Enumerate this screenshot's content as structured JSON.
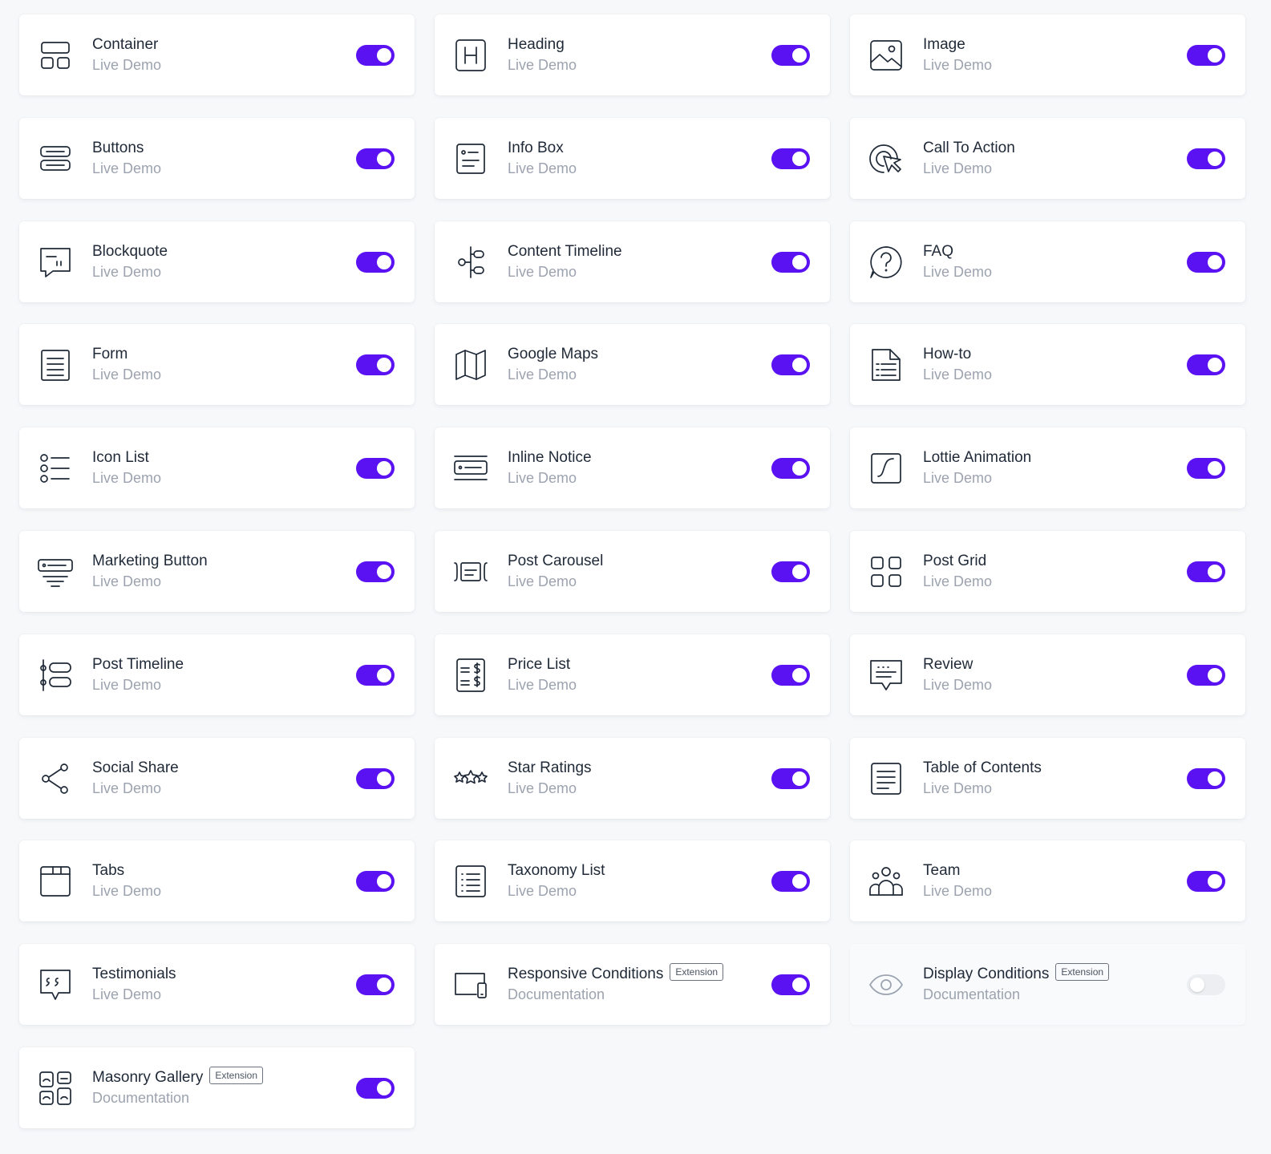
{
  "colors": {
    "accent": "#5b12f2",
    "toggle_off": "#eceef2"
  },
  "widgets": [
    {
      "title": "Container",
      "sub": "Live Demo",
      "icon": "container-icon",
      "on": true
    },
    {
      "title": "Heading",
      "sub": "Live Demo",
      "icon": "heading-icon",
      "on": true
    },
    {
      "title": "Image",
      "sub": "Live Demo",
      "icon": "image-icon",
      "on": true
    },
    {
      "title": "Buttons",
      "sub": "Live Demo",
      "icon": "buttons-icon",
      "on": true
    },
    {
      "title": "Info Box",
      "sub": "Live Demo",
      "icon": "info-box-icon",
      "on": true
    },
    {
      "title": "Call To Action",
      "sub": "Live Demo",
      "icon": "call-to-action-icon",
      "on": true
    },
    {
      "title": "Blockquote",
      "sub": "Live Demo",
      "icon": "blockquote-icon",
      "on": true
    },
    {
      "title": "Content Timeline",
      "sub": "Live Demo",
      "icon": "content-timeline-icon",
      "on": true
    },
    {
      "title": "FAQ",
      "sub": "Live Demo",
      "icon": "faq-icon",
      "on": true
    },
    {
      "title": "Form",
      "sub": "Live Demo",
      "icon": "form-icon",
      "on": true
    },
    {
      "title": "Google Maps",
      "sub": "Live Demo",
      "icon": "map-icon",
      "on": true
    },
    {
      "title": "How-to",
      "sub": "Live Demo",
      "icon": "how-to-icon",
      "on": true
    },
    {
      "title": "Icon List",
      "sub": "Live Demo",
      "icon": "icon-list-icon",
      "on": true
    },
    {
      "title": "Inline Notice",
      "sub": "Live Demo",
      "icon": "inline-notice-icon",
      "on": true
    },
    {
      "title": "Lottie Animation",
      "sub": "Live Demo",
      "icon": "lottie-icon",
      "on": true
    },
    {
      "title": "Marketing Button",
      "sub": "Live Demo",
      "icon": "marketing-button-icon",
      "on": true
    },
    {
      "title": "Post Carousel",
      "sub": "Live Demo",
      "icon": "post-carousel-icon",
      "on": true
    },
    {
      "title": "Post Grid",
      "sub": "Live Demo",
      "icon": "post-grid-icon",
      "on": true
    },
    {
      "title": "Post Timeline",
      "sub": "Live Demo",
      "icon": "post-timeline-icon",
      "on": true
    },
    {
      "title": "Price List",
      "sub": "Live Demo",
      "icon": "price-list-icon",
      "on": true
    },
    {
      "title": "Review",
      "sub": "Live Demo",
      "icon": "review-icon",
      "on": true
    },
    {
      "title": "Social Share",
      "sub": "Live Demo",
      "icon": "share-icon",
      "on": true
    },
    {
      "title": "Star Ratings",
      "sub": "Live Demo",
      "icon": "star-ratings-icon",
      "on": true
    },
    {
      "title": "Table of Contents",
      "sub": "Live Demo",
      "icon": "table-of-contents-icon",
      "on": true
    },
    {
      "title": "Tabs",
      "sub": "Live Demo",
      "icon": "tabs-icon",
      "on": true
    },
    {
      "title": "Taxonomy List",
      "sub": "Live Demo",
      "icon": "taxonomy-list-icon",
      "on": true
    },
    {
      "title": "Team",
      "sub": "Live Demo",
      "icon": "team-icon",
      "on": true
    },
    {
      "title": "Testimonials",
      "sub": "Live Demo",
      "icon": "testimonials-icon",
      "on": true
    },
    {
      "title": "Responsive Conditions",
      "sub": "Documentation",
      "badge": "Extension",
      "icon": "responsive-conditions-icon",
      "on": true
    },
    {
      "title": "Display Conditions",
      "sub": "Documentation",
      "badge": "Extension",
      "icon": "eye-icon",
      "on": false
    },
    {
      "title": "Masonry Gallery",
      "sub": "Documentation",
      "badge": "Extension",
      "icon": "masonry-gallery-icon",
      "on": true
    }
  ]
}
